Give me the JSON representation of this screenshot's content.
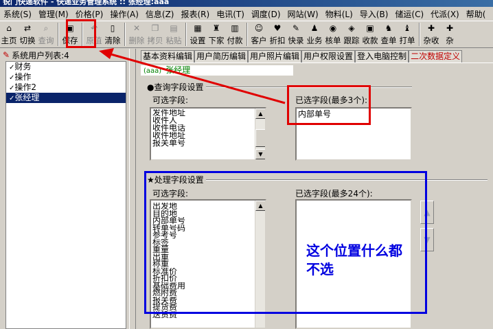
{
  "window": {
    "title": "锐门快递软件 - 快递业务管理系统 :: 张经理:aaa"
  },
  "menubar": [
    "系统(S)",
    "管理(M)",
    "价格(P)",
    "操作(A)",
    "信息(Z)",
    "报表(R)",
    "电讯(T)",
    "调度(D)",
    "网站(W)",
    "物料(L)",
    "导入(B)",
    "储运(C)",
    "代派(X)",
    "帮助("
  ],
  "toolbar": [
    {
      "label": "主页",
      "icon": "home-icon",
      "glyph": "⌂",
      "enabled": true
    },
    {
      "label": "切换",
      "icon": "switch-icon",
      "glyph": "⇄",
      "enabled": true
    },
    {
      "label": "查询",
      "icon": "search-icon",
      "glyph": "⌕",
      "enabled": false
    },
    {
      "label": "保存",
      "icon": "save-icon",
      "glyph": "▣",
      "enabled": true
    },
    {
      "label": "原值",
      "icon": "revert-icon",
      "glyph": "↶",
      "enabled": false
    },
    {
      "label": "清除",
      "icon": "clear-icon",
      "glyph": "▯",
      "enabled": true
    },
    {
      "label": "删除",
      "icon": "delete-icon",
      "glyph": "✕",
      "enabled": false
    },
    {
      "label": "拷贝",
      "icon": "copy-icon",
      "glyph": "❐",
      "enabled": false
    },
    {
      "label": "粘贴",
      "icon": "paste-icon",
      "glyph": "▤",
      "enabled": false
    },
    {
      "label": "设置",
      "icon": "settings-icon",
      "glyph": "▦",
      "enabled": true
    },
    {
      "label": "下家",
      "icon": "next-party-icon",
      "glyph": "♜",
      "enabled": true
    },
    {
      "label": "付款",
      "icon": "payment-icon",
      "glyph": "▥",
      "enabled": true
    },
    {
      "label": "客户",
      "icon": "customer-icon",
      "glyph": "☺",
      "enabled": true
    },
    {
      "label": "折扣",
      "icon": "discount-icon",
      "glyph": "♥",
      "enabled": true
    },
    {
      "label": "快录",
      "icon": "quick-entry-icon",
      "glyph": "✎",
      "enabled": true
    },
    {
      "label": "业务",
      "icon": "business-icon",
      "glyph": "♟",
      "enabled": true
    },
    {
      "label": "核单",
      "icon": "verify-icon",
      "glyph": "◉",
      "enabled": true
    },
    {
      "label": "跟踪",
      "icon": "track-icon",
      "glyph": "◈",
      "enabled": true
    },
    {
      "label": "收款",
      "icon": "receive-icon",
      "glyph": "▣",
      "enabled": true
    },
    {
      "label": "查单",
      "icon": "lookup-order-icon",
      "glyph": "♞",
      "enabled": true
    },
    {
      "label": "打单",
      "icon": "print-icon",
      "glyph": "♝",
      "enabled": true
    },
    {
      "label": "杂收",
      "icon": "misc-income-icon",
      "glyph": "✚",
      "enabled": true
    },
    {
      "label": "杂",
      "icon": "misc-icon",
      "glyph": "✚",
      "enabled": true
    }
  ],
  "left_panel": {
    "title": "系统用户列表:4",
    "users": [
      "财务",
      "操作",
      "操作2",
      "张经理"
    ],
    "selected_index": 3
  },
  "tabs": [
    "基本资料编辑",
    "用户简历编辑",
    "用户照片编辑",
    "用户权限设置",
    "登入电脑控制",
    "二次数据定义"
  ],
  "active_tab_index": 5,
  "current_user": {
    "tag": "(aaa)",
    "name": "张经理"
  },
  "query_section": {
    "title": "●查询字段设置",
    "available_label": "可选字段:",
    "selected_label": "已选字段(最多3个):",
    "available_fields": [
      "发件地址",
      "收件人",
      "收件电话",
      "收件地址",
      "报关单号"
    ],
    "selected_fields": [
      "内部单号"
    ]
  },
  "process_section": {
    "title": "★处理字段设置",
    "available_label": "可选字段:",
    "selected_label": "已选字段(最多24个):",
    "available_fields": [
      "出发地",
      "目的地",
      "内部单号",
      "转单号码",
      "参考号",
      "标签",
      "重量",
      "出重",
      "称重",
      "标准价",
      "折扣价",
      "基础费用",
      "燃附费",
      "报关费",
      "提货费",
      "送货费"
    ],
    "selected_fields": []
  },
  "annotation": "这个位置什么都不选",
  "colors": {
    "red_highlight": "#e00000",
    "blue_highlight": "#0000e0",
    "selection": "#0a246a"
  }
}
